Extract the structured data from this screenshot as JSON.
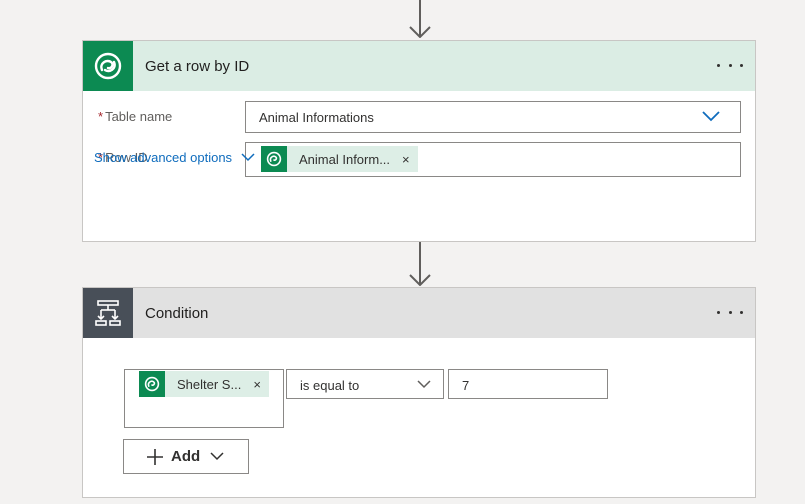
{
  "get_row_action": {
    "title": "Get a row by ID",
    "icon": "dataverse-icon",
    "header_color": "#dbede4",
    "icon_bg": "#0c8a52",
    "table_name": {
      "label": "Table name",
      "required_mark": "*",
      "value": "Animal Informations"
    },
    "row_id": {
      "label": "Row ID",
      "required_mark": "*",
      "token_text": "Animal Inform...",
      "token_remove": "×"
    },
    "advanced_options_label": "Show advanced options"
  },
  "condition_action": {
    "title": "Condition",
    "icon": "condition-icon",
    "header_color": "#e1e1e1",
    "icon_bg": "#484f58",
    "left_operand": {
      "token_text": "Shelter S...",
      "token_remove": "×"
    },
    "operator": "is equal to",
    "right_operand": "7",
    "add_button_label": "Add"
  }
}
